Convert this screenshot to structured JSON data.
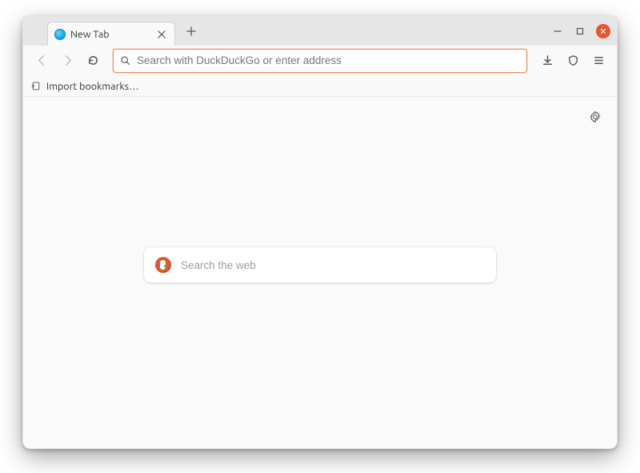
{
  "window": {
    "minimize_icon": "minimize-icon",
    "maximize_icon": "maximize-icon",
    "close_icon": "close-icon"
  },
  "tabs": [
    {
      "title": "New Tab",
      "favicon": "firefox-newtab-icon"
    }
  ],
  "toolbar": {
    "back_icon": "back-icon",
    "forward_icon": "forward-icon",
    "reload_icon": "reload-icon",
    "urlbar_placeholder": "Search with DuckDuckGo or enter address",
    "downloads_icon": "downloads-icon",
    "shield_icon": "shield-icon",
    "menu_icon": "hamburger-menu-icon"
  },
  "bookmarks": {
    "import_label": "Import bookmarks…",
    "import_icon": "import-bookmarks-icon"
  },
  "content": {
    "settings_icon": "gear-icon",
    "search_engine_icon": "duckduckgo-icon",
    "search_placeholder": "Search the web"
  }
}
